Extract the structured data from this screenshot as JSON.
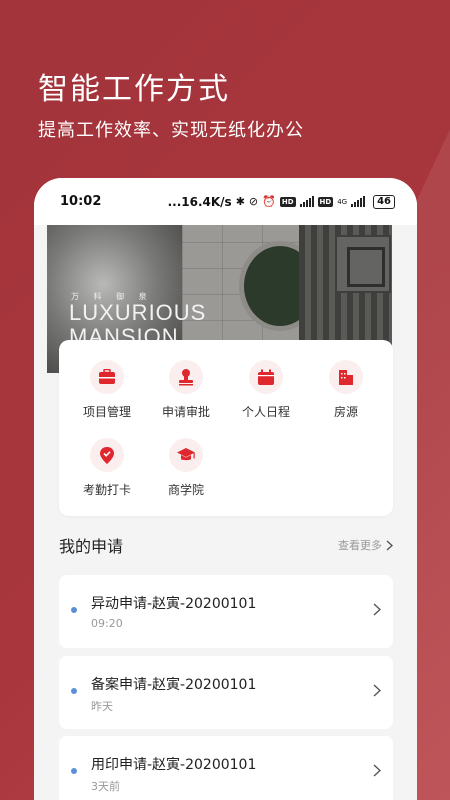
{
  "promo": {
    "title": "智能工作方式",
    "subtitle": "提高工作效率、实现无纸化办公"
  },
  "statusbar": {
    "time": "10:02",
    "network_speed": "...16.4K/s",
    "battery": "46",
    "network_badge": "4G",
    "hd_badge": "HD"
  },
  "banner": {
    "small_text": "万 科 御 泉",
    "line1": "LUXURIOUS",
    "line2": "MANSION"
  },
  "grid": {
    "items": [
      {
        "label": "项目管理",
        "icon": "briefcase-icon"
      },
      {
        "label": "申请审批",
        "icon": "stamp-icon"
      },
      {
        "label": "个人日程",
        "icon": "calendar-icon"
      },
      {
        "label": "房源",
        "icon": "building-icon"
      },
      {
        "label": "考勤打卡",
        "icon": "location-check-icon"
      },
      {
        "label": "商学院",
        "icon": "graduation-cap-icon"
      }
    ]
  },
  "requests": {
    "title": "我的申请",
    "more_label": "查看更多",
    "items": [
      {
        "title": "异动申请-赵寅-20200101",
        "time": "09:20"
      },
      {
        "title": "备案申请-赵寅-20200101",
        "time": "昨天"
      },
      {
        "title": "用印申请-赵寅-20200101",
        "time": "3天前"
      }
    ]
  },
  "colors": {
    "accent": "#e0272e",
    "background": "#a8363c",
    "dot": "#5b8fd8"
  }
}
